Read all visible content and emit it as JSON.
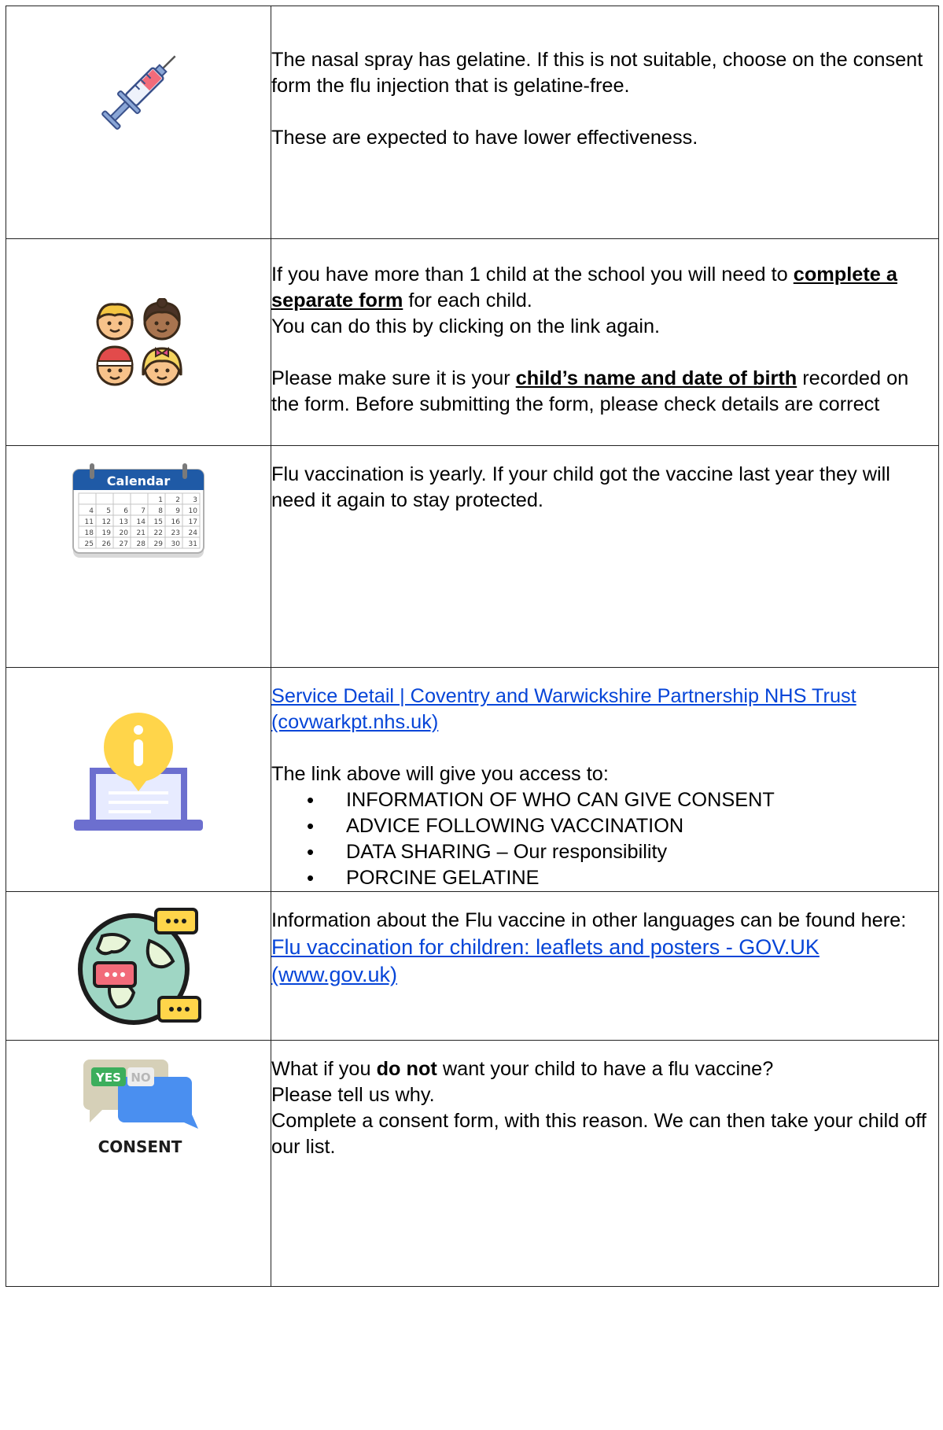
{
  "rows": [
    {
      "icon": "syringe-icon",
      "p1": "The nasal spray has gelatine.  If this is not suitable, choose on the consent form the flu injection that is gelatine-free.",
      "p2": "These are expected to have lower effectiveness."
    },
    {
      "icon": "children-icon",
      "p1_pre": "If you have more than 1 child at the school you will need to ",
      "p1_bold": "complete a separate form",
      "p1_post": " for each child.",
      "p1_line2": "You can do this by clicking on the link again.",
      "p2_pre": "Please make sure it is your ",
      "p2_bold": "child’s name and date of birth",
      "p2_post": " recorded on the form. Before submitting the form, please check details are correct"
    },
    {
      "icon": "calendar-icon",
      "calendar_title": "Calendar",
      "calendar_days": [
        "1",
        "2",
        "3",
        "4",
        "5",
        "6",
        "7",
        "8",
        "9",
        "10",
        "11",
        "12",
        "13",
        "14",
        "15",
        "16",
        "17",
        "18",
        "19",
        "20",
        "21",
        "22",
        "23",
        "24",
        "25",
        "26",
        "27",
        "28",
        "29",
        "30",
        "31"
      ],
      "p1": "Flu vaccination is yearly.  If your child got the vaccine last year they will need it again to stay protected."
    },
    {
      "icon": "info-laptop-icon",
      "link": "Service Detail | Coventry and Warwickshire Partnership NHS Trust (covwarkpt.nhs.uk)",
      "intro": "The link above will give you access to:",
      "bullets": [
        "INFORMATION OF WHO CAN GIVE CONSENT",
        "ADVICE FOLLOWING VACCINATION",
        "DATA SHARING – Our responsibility",
        "PORCINE GELATINE"
      ]
    },
    {
      "icon": "globe-chat-icon",
      "p1": "Information about the Flu vaccine in other languages can be found here:",
      "link": "Flu vaccination for children: leaflets and posters - GOV.UK (www.gov.uk)"
    },
    {
      "icon": "consent-icon",
      "yes_label": "YES",
      "no_label": "NO",
      "consent_label": "CONSENT",
      "p1_pre": "What if you ",
      "p1_bold": "do not",
      "p1_post": " want your child to have a flu vaccine?",
      "p1_line2": "Please tell us why.",
      "p2": "Complete a consent form, with this reason.  We can then take your child off our list."
    }
  ],
  "colors": {
    "link": "#0645d8",
    "border": "#222222",
    "calendar_header": "#1f5aa6",
    "info_yellow": "#ffd54a",
    "laptop_purple": "#6c6fcf",
    "consent_green": "#3cae5c"
  }
}
